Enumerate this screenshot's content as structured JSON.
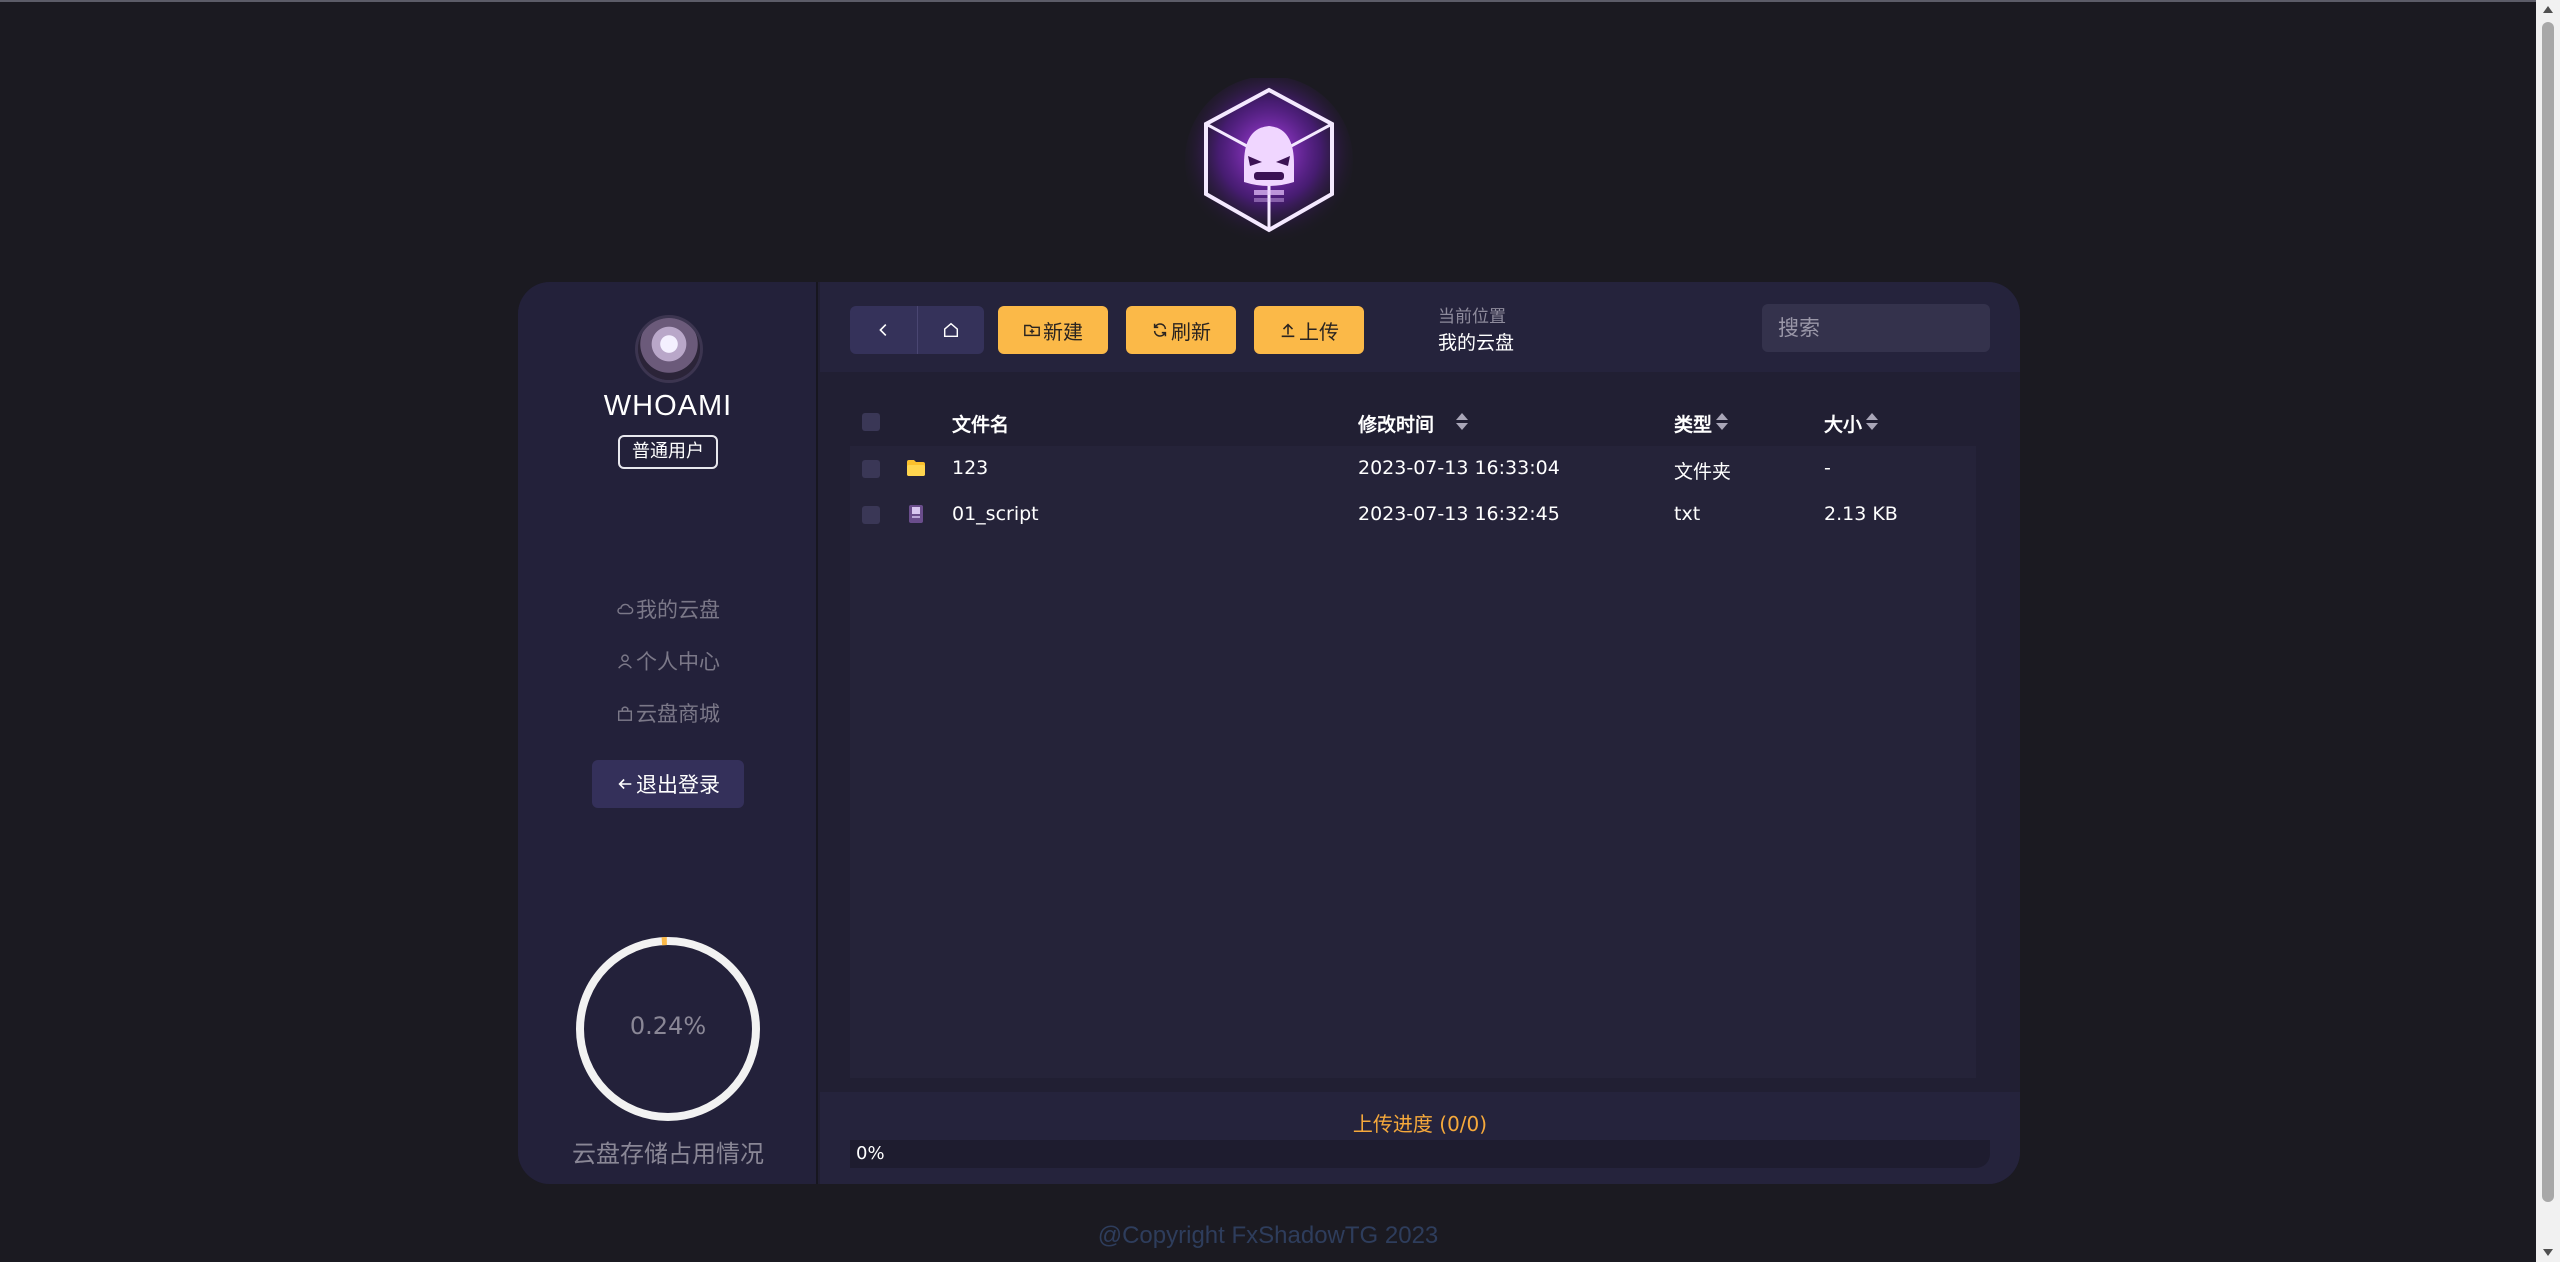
{
  "sidebar": {
    "username": "WHOAMI",
    "role": "普通用户",
    "nav": [
      {
        "label": "我的云盘",
        "icon": "cloud-icon"
      },
      {
        "label": "个人中心",
        "icon": "user-icon"
      },
      {
        "label": "云盘商城",
        "icon": "shop-icon"
      }
    ],
    "logout_label": "退出登录",
    "usage_percent_text": "0.24%",
    "usage_fraction": 0.0024,
    "usage_label": "云盘存储占用情况"
  },
  "toolbar": {
    "new_label": "新建",
    "refresh_label": "刷新",
    "upload_label": "上传",
    "location_label": "当前位置",
    "location_value": "我的云盘",
    "search_placeholder": "搜索"
  },
  "table": {
    "headers": {
      "name": "文件名",
      "modified": "修改时间",
      "type": "类型",
      "size": "大小"
    },
    "rows": [
      {
        "name": "123",
        "modified": "2023-07-13 16:33:04",
        "type": "文件夹",
        "size": "-",
        "icon": "folder-icon"
      },
      {
        "name": "01_script",
        "modified": "2023-07-13 16:32:45",
        "type": "txt",
        "size": "2.13 KB",
        "icon": "file-icon"
      }
    ]
  },
  "upload": {
    "title": "上传进度 (0/0)",
    "progress_text": "0%",
    "progress_fraction": 0
  },
  "footer": "@Copyright FxShadowTG 2023",
  "colors": {
    "background": "#1b1a21",
    "panel": "#211f33",
    "accent": "#fbb948",
    "progress_title": "#f6a93b",
    "ring": "#f2f2f2"
  }
}
